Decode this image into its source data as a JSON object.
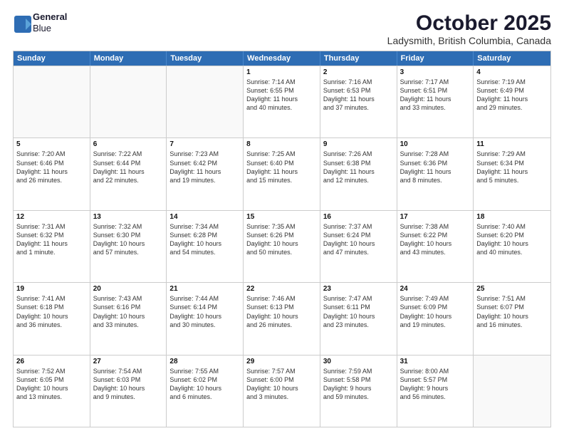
{
  "logo": {
    "line1": "General",
    "line2": "Blue"
  },
  "header": {
    "title": "October 2025",
    "subtitle": "Ladysmith, British Columbia, Canada"
  },
  "days_of_week": [
    "Sunday",
    "Monday",
    "Tuesday",
    "Wednesday",
    "Thursday",
    "Friday",
    "Saturday"
  ],
  "weeks": [
    [
      {
        "day": "",
        "empty": true
      },
      {
        "day": "",
        "empty": true
      },
      {
        "day": "",
        "empty": true
      },
      {
        "day": "1",
        "lines": [
          "Sunrise: 7:14 AM",
          "Sunset: 6:55 PM",
          "Daylight: 11 hours",
          "and 40 minutes."
        ]
      },
      {
        "day": "2",
        "lines": [
          "Sunrise: 7:16 AM",
          "Sunset: 6:53 PM",
          "Daylight: 11 hours",
          "and 37 minutes."
        ]
      },
      {
        "day": "3",
        "lines": [
          "Sunrise: 7:17 AM",
          "Sunset: 6:51 PM",
          "Daylight: 11 hours",
          "and 33 minutes."
        ]
      },
      {
        "day": "4",
        "lines": [
          "Sunrise: 7:19 AM",
          "Sunset: 6:49 PM",
          "Daylight: 11 hours",
          "and 29 minutes."
        ]
      }
    ],
    [
      {
        "day": "5",
        "lines": [
          "Sunrise: 7:20 AM",
          "Sunset: 6:46 PM",
          "Daylight: 11 hours",
          "and 26 minutes."
        ]
      },
      {
        "day": "6",
        "lines": [
          "Sunrise: 7:22 AM",
          "Sunset: 6:44 PM",
          "Daylight: 11 hours",
          "and 22 minutes."
        ]
      },
      {
        "day": "7",
        "lines": [
          "Sunrise: 7:23 AM",
          "Sunset: 6:42 PM",
          "Daylight: 11 hours",
          "and 19 minutes."
        ]
      },
      {
        "day": "8",
        "lines": [
          "Sunrise: 7:25 AM",
          "Sunset: 6:40 PM",
          "Daylight: 11 hours",
          "and 15 minutes."
        ]
      },
      {
        "day": "9",
        "lines": [
          "Sunrise: 7:26 AM",
          "Sunset: 6:38 PM",
          "Daylight: 11 hours",
          "and 12 minutes."
        ]
      },
      {
        "day": "10",
        "lines": [
          "Sunrise: 7:28 AM",
          "Sunset: 6:36 PM",
          "Daylight: 11 hours",
          "and 8 minutes."
        ]
      },
      {
        "day": "11",
        "lines": [
          "Sunrise: 7:29 AM",
          "Sunset: 6:34 PM",
          "Daylight: 11 hours",
          "and 5 minutes."
        ]
      }
    ],
    [
      {
        "day": "12",
        "lines": [
          "Sunrise: 7:31 AM",
          "Sunset: 6:32 PM",
          "Daylight: 11 hours",
          "and 1 minute."
        ]
      },
      {
        "day": "13",
        "lines": [
          "Sunrise: 7:32 AM",
          "Sunset: 6:30 PM",
          "Daylight: 10 hours",
          "and 57 minutes."
        ]
      },
      {
        "day": "14",
        "lines": [
          "Sunrise: 7:34 AM",
          "Sunset: 6:28 PM",
          "Daylight: 10 hours",
          "and 54 minutes."
        ]
      },
      {
        "day": "15",
        "lines": [
          "Sunrise: 7:35 AM",
          "Sunset: 6:26 PM",
          "Daylight: 10 hours",
          "and 50 minutes."
        ]
      },
      {
        "day": "16",
        "lines": [
          "Sunrise: 7:37 AM",
          "Sunset: 6:24 PM",
          "Daylight: 10 hours",
          "and 47 minutes."
        ]
      },
      {
        "day": "17",
        "lines": [
          "Sunrise: 7:38 AM",
          "Sunset: 6:22 PM",
          "Daylight: 10 hours",
          "and 43 minutes."
        ]
      },
      {
        "day": "18",
        "lines": [
          "Sunrise: 7:40 AM",
          "Sunset: 6:20 PM",
          "Daylight: 10 hours",
          "and 40 minutes."
        ]
      }
    ],
    [
      {
        "day": "19",
        "lines": [
          "Sunrise: 7:41 AM",
          "Sunset: 6:18 PM",
          "Daylight: 10 hours",
          "and 36 minutes."
        ]
      },
      {
        "day": "20",
        "lines": [
          "Sunrise: 7:43 AM",
          "Sunset: 6:16 PM",
          "Daylight: 10 hours",
          "and 33 minutes."
        ]
      },
      {
        "day": "21",
        "lines": [
          "Sunrise: 7:44 AM",
          "Sunset: 6:14 PM",
          "Daylight: 10 hours",
          "and 30 minutes."
        ]
      },
      {
        "day": "22",
        "lines": [
          "Sunrise: 7:46 AM",
          "Sunset: 6:13 PM",
          "Daylight: 10 hours",
          "and 26 minutes."
        ]
      },
      {
        "day": "23",
        "lines": [
          "Sunrise: 7:47 AM",
          "Sunset: 6:11 PM",
          "Daylight: 10 hours",
          "and 23 minutes."
        ]
      },
      {
        "day": "24",
        "lines": [
          "Sunrise: 7:49 AM",
          "Sunset: 6:09 PM",
          "Daylight: 10 hours",
          "and 19 minutes."
        ]
      },
      {
        "day": "25",
        "lines": [
          "Sunrise: 7:51 AM",
          "Sunset: 6:07 PM",
          "Daylight: 10 hours",
          "and 16 minutes."
        ]
      }
    ],
    [
      {
        "day": "26",
        "lines": [
          "Sunrise: 7:52 AM",
          "Sunset: 6:05 PM",
          "Daylight: 10 hours",
          "and 13 minutes."
        ]
      },
      {
        "day": "27",
        "lines": [
          "Sunrise: 7:54 AM",
          "Sunset: 6:03 PM",
          "Daylight: 10 hours",
          "and 9 minutes."
        ]
      },
      {
        "day": "28",
        "lines": [
          "Sunrise: 7:55 AM",
          "Sunset: 6:02 PM",
          "Daylight: 10 hours",
          "and 6 minutes."
        ]
      },
      {
        "day": "29",
        "lines": [
          "Sunrise: 7:57 AM",
          "Sunset: 6:00 PM",
          "Daylight: 10 hours",
          "and 3 minutes."
        ]
      },
      {
        "day": "30",
        "lines": [
          "Sunrise: 7:59 AM",
          "Sunset: 5:58 PM",
          "Daylight: 9 hours",
          "and 59 minutes."
        ]
      },
      {
        "day": "31",
        "lines": [
          "Sunrise: 8:00 AM",
          "Sunset: 5:57 PM",
          "Daylight: 9 hours",
          "and 56 minutes."
        ]
      },
      {
        "day": "",
        "empty": true
      }
    ]
  ]
}
